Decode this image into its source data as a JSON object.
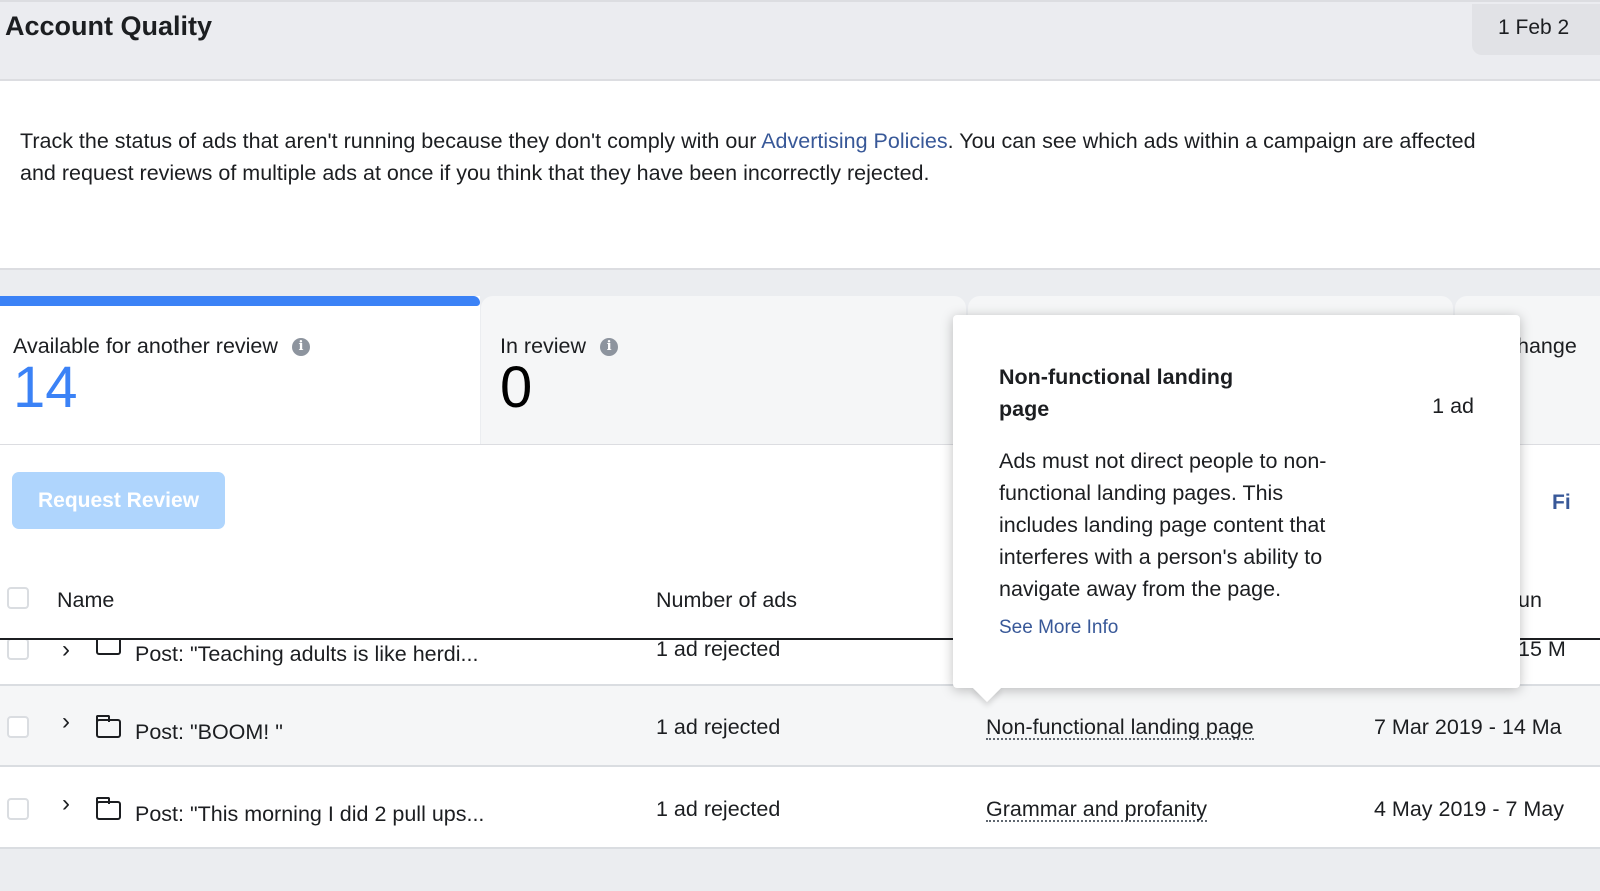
{
  "header": {
    "title": "Account Quality",
    "date_range": "1 Feb 2"
  },
  "description": {
    "text_before": "Track the status of ads that aren't running because they don't comply with our ",
    "link": "Advertising Policies",
    "text_after": ". You can see which ads within a campaign are affected and request reviews of multiple ads at once if you think that they have been incorrectly rejected."
  },
  "tabs": [
    {
      "label": "Available for another review",
      "count": "14",
      "active": true
    },
    {
      "label": "In review",
      "count": "0",
      "active": false
    },
    {
      "label": "",
      "count": "",
      "active": false
    },
    {
      "label": "hange",
      "count": "",
      "active": false
    }
  ],
  "toolbar": {
    "request_review_label": "Request Review",
    "filter_peek": "Fi"
  },
  "table": {
    "columns": [
      "Name",
      "Number of ads",
      "un"
    ],
    "rows": [
      {
        "name": "Post: \"Teaching adults is like herdi...",
        "ads": "1 ad rejected",
        "reason": "",
        "dates": "15 M"
      },
      {
        "name": "Post: \"BOOM! \"",
        "ads": "1 ad rejected",
        "reason": "Non-functional landing page",
        "dates": "7 Mar 2019 - 14 Ma"
      },
      {
        "name": "Post: \"This morning I did 2 pull ups...",
        "ads": "1 ad rejected",
        "reason": "Grammar and profanity",
        "dates": "4 May 2019 - 7 May"
      }
    ]
  },
  "tooltip": {
    "title": "Non-functional landing page",
    "count": "1 ad",
    "body": "Ads must not direct people to non-functional landing pages. This includes landing page content that interferes with a person's ability to navigate away from the page.",
    "link": "See More Info"
  },
  "colors": {
    "accent": "#3b82f6",
    "link": "#385898",
    "button_disabled": "#afd5fd"
  }
}
